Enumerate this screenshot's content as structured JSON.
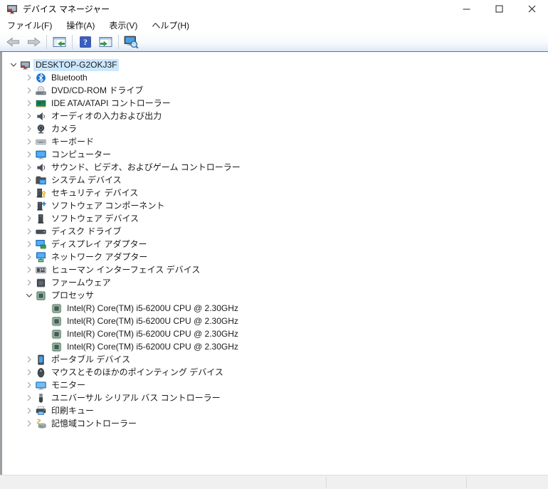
{
  "window": {
    "title": "デバイス マネージャー",
    "app_icon": "device-manager-icon",
    "controls": [
      {
        "id": "minimize",
        "icon": "minimize-icon"
      },
      {
        "id": "maximize",
        "icon": "maximize-icon"
      },
      {
        "id": "close",
        "icon": "close-icon"
      }
    ]
  },
  "menu": {
    "items": [
      {
        "id": "file",
        "label": "ファイル(F)"
      },
      {
        "id": "action",
        "label": "操作(A)"
      },
      {
        "id": "view",
        "label": "表示(V)"
      },
      {
        "id": "help",
        "label": "ヘルプ(H)"
      }
    ]
  },
  "toolbar": {
    "buttons": [
      {
        "id": "back",
        "icon": "arrow-left-icon"
      },
      {
        "id": "forward",
        "icon": "arrow-right-icon"
      },
      {
        "id": "sep-1",
        "separator": true
      },
      {
        "id": "show-console-tree",
        "icon": "console-tree-icon"
      },
      {
        "id": "sep-2",
        "separator": true
      },
      {
        "id": "help",
        "icon": "help-icon"
      },
      {
        "id": "show-action-pane",
        "icon": "action-pane-icon"
      },
      {
        "id": "sep-3",
        "separator": true
      },
      {
        "id": "scan-hardware-changes",
        "icon": "scan-hardware-icon"
      }
    ]
  },
  "tree": {
    "items": [
      {
        "label": "DESKTOP-G2OKJ3F",
        "icon": "computer-icon",
        "level": 0,
        "state": "expanded",
        "selected": true
      },
      {
        "label": "Bluetooth",
        "icon": "bluetooth-icon",
        "level": 1,
        "state": "collapsed"
      },
      {
        "label": "DVD/CD-ROM ドライブ",
        "icon": "dvd-drive-icon",
        "level": 1,
        "state": "collapsed"
      },
      {
        "label": "IDE ATA/ATAPI コントローラー",
        "icon": "ide-controller-icon",
        "level": 1,
        "state": "collapsed"
      },
      {
        "label": "オーディオの入力および出力",
        "icon": "audio-io-icon",
        "level": 1,
        "state": "collapsed"
      },
      {
        "label": "カメラ",
        "icon": "camera-icon",
        "level": 1,
        "state": "collapsed"
      },
      {
        "label": "キーボード",
        "icon": "keyboard-icon",
        "level": 1,
        "state": "collapsed"
      },
      {
        "label": "コンピューター",
        "icon": "computer-monitor-icon",
        "level": 1,
        "state": "collapsed"
      },
      {
        "label": "サウンド、ビデオ、およびゲーム コントローラー",
        "icon": "sound-icon",
        "level": 1,
        "state": "collapsed"
      },
      {
        "label": "システム デバイス",
        "icon": "system-device-icon",
        "level": 1,
        "state": "collapsed"
      },
      {
        "label": "セキュリティ デバイス",
        "icon": "security-device-icon",
        "level": 1,
        "state": "collapsed"
      },
      {
        "label": "ソフトウェア コンポーネント",
        "icon": "software-component-icon",
        "level": 1,
        "state": "collapsed"
      },
      {
        "label": "ソフトウェア デバイス",
        "icon": "software-device-icon",
        "level": 1,
        "state": "collapsed"
      },
      {
        "label": "ディスク ドライブ",
        "icon": "disk-drive-icon",
        "level": 1,
        "state": "collapsed"
      },
      {
        "label": "ディスプレイ アダプター",
        "icon": "display-adapter-icon",
        "level": 1,
        "state": "collapsed"
      },
      {
        "label": "ネットワーク アダプター",
        "icon": "network-adapter-icon",
        "level": 1,
        "state": "collapsed"
      },
      {
        "label": "ヒューマン インターフェイス デバイス",
        "icon": "hid-icon",
        "level": 1,
        "state": "collapsed"
      },
      {
        "label": "ファームウェア",
        "icon": "firmware-icon",
        "level": 1,
        "state": "collapsed"
      },
      {
        "label": "プロセッサ",
        "icon": "processor-icon",
        "level": 1,
        "state": "expanded"
      },
      {
        "label": "Intel(R) Core(TM) i5-6200U CPU @ 2.30GHz",
        "icon": "processor-icon",
        "level": 2,
        "state": "leaf"
      },
      {
        "label": "Intel(R) Core(TM) i5-6200U CPU @ 2.30GHz",
        "icon": "processor-icon",
        "level": 2,
        "state": "leaf"
      },
      {
        "label": "Intel(R) Core(TM) i5-6200U CPU @ 2.30GHz",
        "icon": "processor-icon",
        "level": 2,
        "state": "leaf"
      },
      {
        "label": "Intel(R) Core(TM) i5-6200U CPU @ 2.30GHz",
        "icon": "processor-icon",
        "level": 2,
        "state": "leaf"
      },
      {
        "label": "ポータブル デバイス",
        "icon": "portable-device-icon",
        "level": 1,
        "state": "collapsed"
      },
      {
        "label": "マウスとそのほかのポインティング デバイス",
        "icon": "mouse-icon",
        "level": 1,
        "state": "collapsed"
      },
      {
        "label": "モニター",
        "icon": "monitor-icon",
        "level": 1,
        "state": "collapsed"
      },
      {
        "label": "ユニバーサル シリアル バス コントローラー",
        "icon": "usb-icon",
        "level": 1,
        "state": "collapsed"
      },
      {
        "label": "印刷キュー",
        "icon": "print-queue-icon",
        "level": 1,
        "state": "collapsed"
      },
      {
        "label": "記憶域コントローラー",
        "icon": "storage-controller-icon",
        "level": 1,
        "state": "collapsed"
      }
    ]
  },
  "colors": {
    "selection_highlight": "#cce8ff",
    "toolbar_bottom_border": "#68707c",
    "status_bar_background": "#f0f0f0",
    "tree_text": "#1a1a1a"
  }
}
